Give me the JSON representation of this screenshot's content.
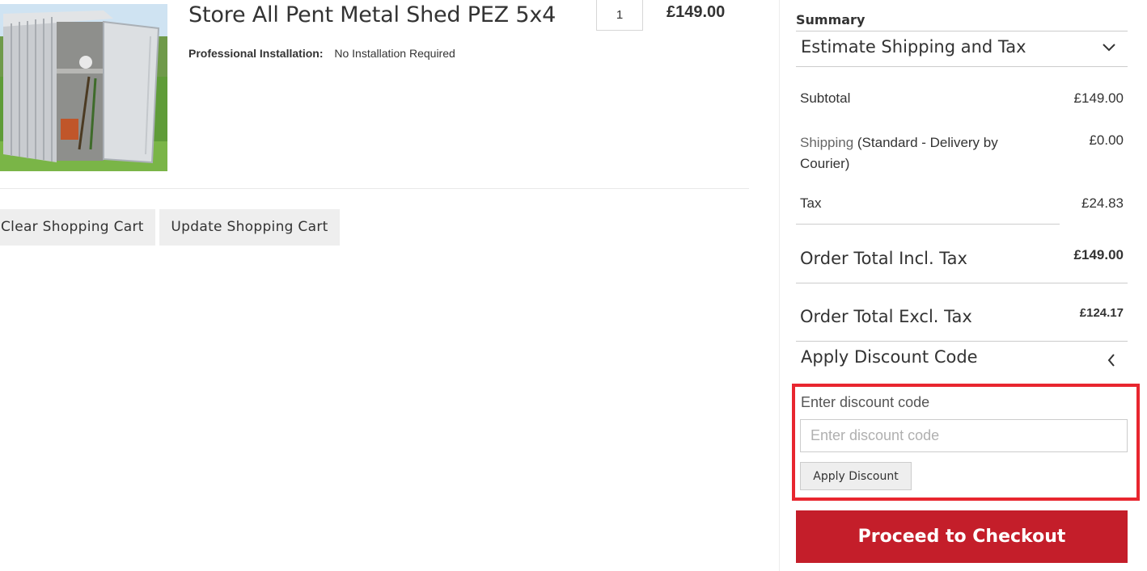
{
  "item": {
    "name": "Store All Pent Metal Shed PEZ 5x4",
    "option_label": "Professional Installation:",
    "option_value": "No Installation Required",
    "qty": "1",
    "price": "£149.00",
    "image_icon": "metal-shed-photo"
  },
  "cart_actions": {
    "clear_label": "Clear Shopping Cart",
    "update_label": "Update Shopping Cart"
  },
  "summary": {
    "title": "Summary",
    "shipping_estimate_label": "Estimate Shipping and Tax",
    "subtotal_label": "Subtotal",
    "subtotal_value": "£149.00",
    "shipping_label": "Shipping",
    "shipping_detail": " (Standard - Delivery by Courier)",
    "shipping_value": "£0.00",
    "tax_label": "Tax",
    "tax_value": "£24.83",
    "total_incl_label": "Order Total Incl. Tax",
    "total_incl_value": "£149.00",
    "total_excl_label": "Order Total Excl. Tax",
    "total_excl_value": "£124.17"
  },
  "discount": {
    "section_label": "Apply Discount Code",
    "field_label": "Enter discount code",
    "placeholder": "Enter discount code",
    "apply_label": "Apply Discount"
  },
  "checkout": {
    "label": "Proceed to Checkout"
  },
  "colors": {
    "checkout_bg": "#c41e2a",
    "highlight_border": "#e8262f",
    "button_bg": "#eeeeee"
  }
}
